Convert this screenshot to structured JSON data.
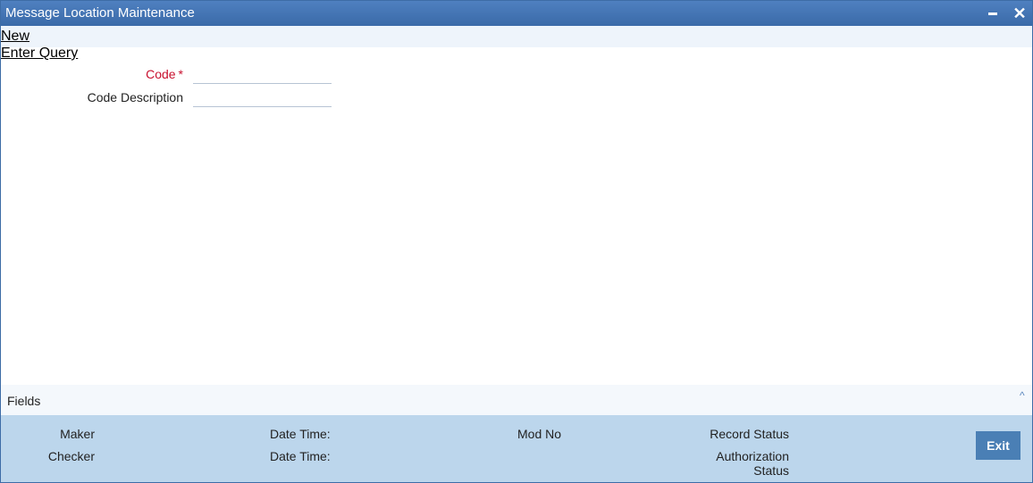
{
  "window": {
    "title": "Message Location Maintenance",
    "minimize_icon": "minimize-icon",
    "close_icon": "close-icon",
    "close_glyph": "✕"
  },
  "actions": {
    "new_label": "New",
    "enter_query_label": "Enter Query"
  },
  "form": {
    "code_label": "Code",
    "required_marker": "*",
    "code_value": "",
    "code_description_label": "Code Description",
    "code_description_value": ""
  },
  "fields_section": {
    "label": "Fields",
    "collapse_icon": "chevron-up-icon",
    "collapse_glyph": "^"
  },
  "audit": {
    "maker_label": "Maker",
    "checker_label": "Checker",
    "maker_datetime_label": "Date Time:",
    "checker_datetime_label": "Date Time:",
    "mod_no_label": "Mod No",
    "record_status_label": "Record Status",
    "authorization_label": "Authorization",
    "status_label": "Status",
    "exit_label": "Exit"
  },
  "colors": {
    "titlebar": "#3a6aa8",
    "required": "#c8102e",
    "audit_bg": "#bcd6ec",
    "exit_button": "#4a7fb5"
  }
}
